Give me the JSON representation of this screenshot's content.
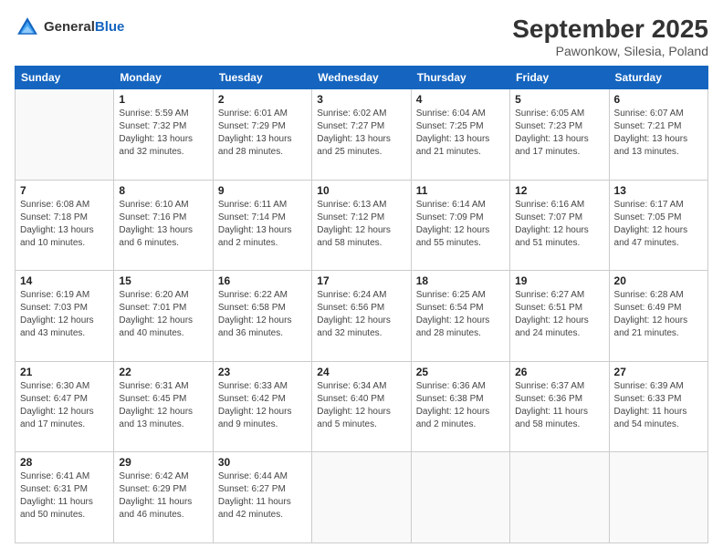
{
  "header": {
    "logo_text_general": "General",
    "logo_text_blue": "Blue",
    "month": "September 2025",
    "location": "Pawonkow, Silesia, Poland"
  },
  "days_of_week": [
    "Sunday",
    "Monday",
    "Tuesday",
    "Wednesday",
    "Thursday",
    "Friday",
    "Saturday"
  ],
  "weeks": [
    [
      {
        "day": "",
        "info": ""
      },
      {
        "day": "1",
        "info": "Sunrise: 5:59 AM\nSunset: 7:32 PM\nDaylight: 13 hours\nand 32 minutes."
      },
      {
        "day": "2",
        "info": "Sunrise: 6:01 AM\nSunset: 7:29 PM\nDaylight: 13 hours\nand 28 minutes."
      },
      {
        "day": "3",
        "info": "Sunrise: 6:02 AM\nSunset: 7:27 PM\nDaylight: 13 hours\nand 25 minutes."
      },
      {
        "day": "4",
        "info": "Sunrise: 6:04 AM\nSunset: 7:25 PM\nDaylight: 13 hours\nand 21 minutes."
      },
      {
        "day": "5",
        "info": "Sunrise: 6:05 AM\nSunset: 7:23 PM\nDaylight: 13 hours\nand 17 minutes."
      },
      {
        "day": "6",
        "info": "Sunrise: 6:07 AM\nSunset: 7:21 PM\nDaylight: 13 hours\nand 13 minutes."
      }
    ],
    [
      {
        "day": "7",
        "info": "Sunrise: 6:08 AM\nSunset: 7:18 PM\nDaylight: 13 hours\nand 10 minutes."
      },
      {
        "day": "8",
        "info": "Sunrise: 6:10 AM\nSunset: 7:16 PM\nDaylight: 13 hours\nand 6 minutes."
      },
      {
        "day": "9",
        "info": "Sunrise: 6:11 AM\nSunset: 7:14 PM\nDaylight: 13 hours\nand 2 minutes."
      },
      {
        "day": "10",
        "info": "Sunrise: 6:13 AM\nSunset: 7:12 PM\nDaylight: 12 hours\nand 58 minutes."
      },
      {
        "day": "11",
        "info": "Sunrise: 6:14 AM\nSunset: 7:09 PM\nDaylight: 12 hours\nand 55 minutes."
      },
      {
        "day": "12",
        "info": "Sunrise: 6:16 AM\nSunset: 7:07 PM\nDaylight: 12 hours\nand 51 minutes."
      },
      {
        "day": "13",
        "info": "Sunrise: 6:17 AM\nSunset: 7:05 PM\nDaylight: 12 hours\nand 47 minutes."
      }
    ],
    [
      {
        "day": "14",
        "info": "Sunrise: 6:19 AM\nSunset: 7:03 PM\nDaylight: 12 hours\nand 43 minutes."
      },
      {
        "day": "15",
        "info": "Sunrise: 6:20 AM\nSunset: 7:01 PM\nDaylight: 12 hours\nand 40 minutes."
      },
      {
        "day": "16",
        "info": "Sunrise: 6:22 AM\nSunset: 6:58 PM\nDaylight: 12 hours\nand 36 minutes."
      },
      {
        "day": "17",
        "info": "Sunrise: 6:24 AM\nSunset: 6:56 PM\nDaylight: 12 hours\nand 32 minutes."
      },
      {
        "day": "18",
        "info": "Sunrise: 6:25 AM\nSunset: 6:54 PM\nDaylight: 12 hours\nand 28 minutes."
      },
      {
        "day": "19",
        "info": "Sunrise: 6:27 AM\nSunset: 6:51 PM\nDaylight: 12 hours\nand 24 minutes."
      },
      {
        "day": "20",
        "info": "Sunrise: 6:28 AM\nSunset: 6:49 PM\nDaylight: 12 hours\nand 21 minutes."
      }
    ],
    [
      {
        "day": "21",
        "info": "Sunrise: 6:30 AM\nSunset: 6:47 PM\nDaylight: 12 hours\nand 17 minutes."
      },
      {
        "day": "22",
        "info": "Sunrise: 6:31 AM\nSunset: 6:45 PM\nDaylight: 12 hours\nand 13 minutes."
      },
      {
        "day": "23",
        "info": "Sunrise: 6:33 AM\nSunset: 6:42 PM\nDaylight: 12 hours\nand 9 minutes."
      },
      {
        "day": "24",
        "info": "Sunrise: 6:34 AM\nSunset: 6:40 PM\nDaylight: 12 hours\nand 5 minutes."
      },
      {
        "day": "25",
        "info": "Sunrise: 6:36 AM\nSunset: 6:38 PM\nDaylight: 12 hours\nand 2 minutes."
      },
      {
        "day": "26",
        "info": "Sunrise: 6:37 AM\nSunset: 6:36 PM\nDaylight: 11 hours\nand 58 minutes."
      },
      {
        "day": "27",
        "info": "Sunrise: 6:39 AM\nSunset: 6:33 PM\nDaylight: 11 hours\nand 54 minutes."
      }
    ],
    [
      {
        "day": "28",
        "info": "Sunrise: 6:41 AM\nSunset: 6:31 PM\nDaylight: 11 hours\nand 50 minutes."
      },
      {
        "day": "29",
        "info": "Sunrise: 6:42 AM\nSunset: 6:29 PM\nDaylight: 11 hours\nand 46 minutes."
      },
      {
        "day": "30",
        "info": "Sunrise: 6:44 AM\nSunset: 6:27 PM\nDaylight: 11 hours\nand 42 minutes."
      },
      {
        "day": "",
        "info": ""
      },
      {
        "day": "",
        "info": ""
      },
      {
        "day": "",
        "info": ""
      },
      {
        "day": "",
        "info": ""
      }
    ]
  ]
}
